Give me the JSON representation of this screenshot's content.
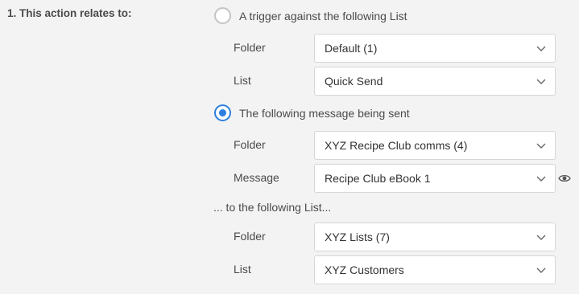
{
  "section": {
    "label": "1. This action relates to:"
  },
  "option_list": {
    "label": "A trigger against the following List",
    "checked": false,
    "folder": {
      "label": "Folder",
      "value": "Default (1)"
    },
    "list": {
      "label": "List",
      "value": "Quick Send"
    }
  },
  "option_message": {
    "label": "The following message being sent",
    "checked": true,
    "folder": {
      "label": "Folder",
      "value": "XYZ Recipe Club comms (4)"
    },
    "message": {
      "label": "Message",
      "value": "Recipe Club eBook 1",
      "preview_icon": "eye-icon"
    }
  },
  "target": {
    "heading": "... to the following List...",
    "folder": {
      "label": "Folder",
      "value": "XYZ Lists (7)"
    },
    "list": {
      "label": "List",
      "value": "XYZ Customers"
    }
  },
  "colors": {
    "accent": "#2d7fe0",
    "background": "#f3f3f3",
    "input_border": "#d6d6d6"
  }
}
